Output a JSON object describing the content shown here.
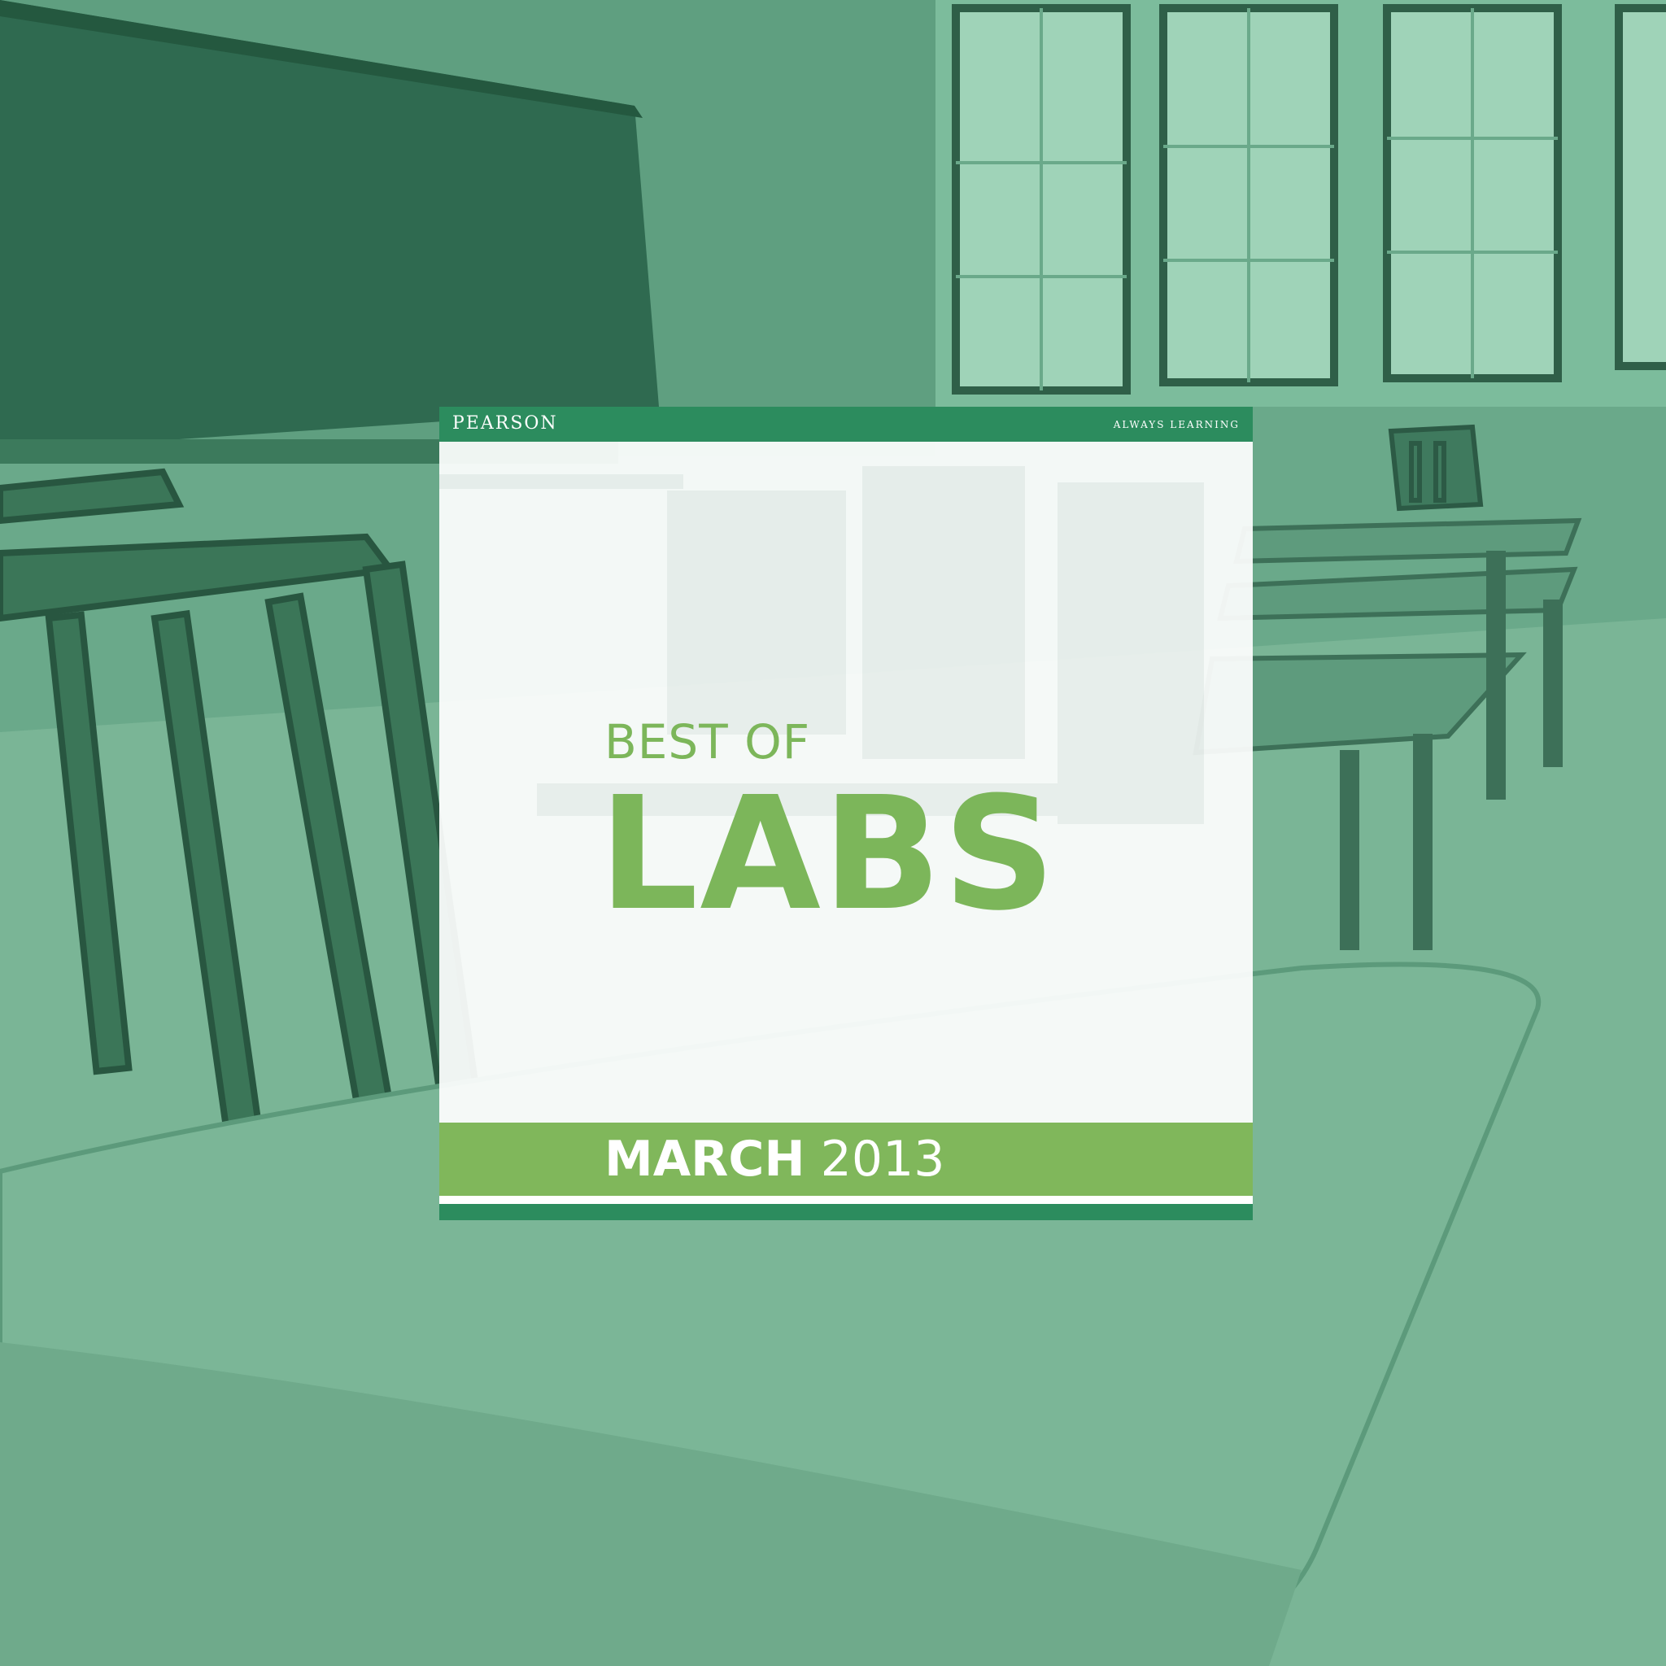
{
  "card": {
    "brand": "PEARSON",
    "tagline": "ALWAYS LEARNING",
    "kicker": "BEST OF",
    "headline": "LABS",
    "date_month": "MARCH",
    "date_year": "2013"
  },
  "colors": {
    "brand_green": "#2c8c5e",
    "accent_green": "#7cb65a",
    "photo_tint": "#5a9a7c"
  },
  "background": {
    "icon": "classroom-photo"
  }
}
